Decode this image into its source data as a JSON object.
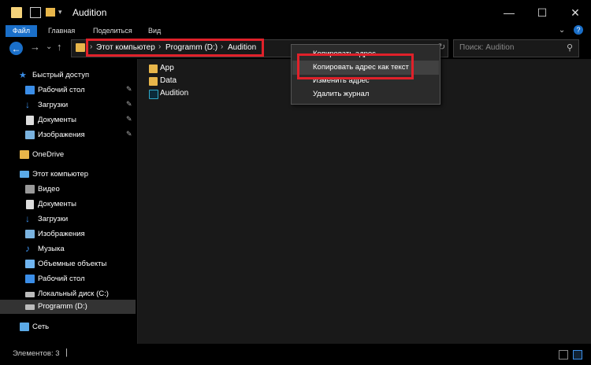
{
  "window": {
    "title": "Audition",
    "minimize": "—",
    "maximize": "☐",
    "close": "✕"
  },
  "ribbon": {
    "tabs": [
      "Файл",
      "Главная",
      "Поделиться",
      "Вид"
    ],
    "expand_glyph": "⌄",
    "help_glyph": "?"
  },
  "nav_glyphs": {
    "back": "←",
    "forward": "→",
    "recent": "⌄",
    "up": "↑"
  },
  "address": {
    "crumbs": [
      "Этот компьютер",
      "Programm (D:)",
      "Audition"
    ],
    "separator": "›",
    "refresh_glyph": "↻"
  },
  "search": {
    "placeholder": "Поиск: Audition",
    "icon_glyph": "⚲"
  },
  "nav_pane": {
    "quick_access": "Быстрый доступ",
    "quick_items": [
      "Рабочий стол",
      "Загрузки",
      "Документы",
      "Изображения"
    ],
    "pin_glyph": "📌",
    "onedrive": "OneDrive",
    "this_pc": "Этот компьютер",
    "pc_items": [
      "Видео",
      "Документы",
      "Загрузки",
      "Изображения",
      "Музыка",
      "Объемные объекты",
      "Рабочий стол",
      "Локальный диск (C:)",
      "Programm (D:)"
    ],
    "network": "Сеть"
  },
  "files": [
    "App",
    "Data",
    "Audition"
  ],
  "context_menu": {
    "items": [
      "Копировать адрес",
      "Копировать адрес как текст",
      "Изменить адрес",
      "Удалить журнал"
    ],
    "highlighted_index": 1
  },
  "status": {
    "items_count": "Элементов: 3",
    "cursor": "|"
  },
  "colors": {
    "accent": "#1a6fc9",
    "folder": "#e8b64a",
    "highlight_box": "#e0212a"
  }
}
